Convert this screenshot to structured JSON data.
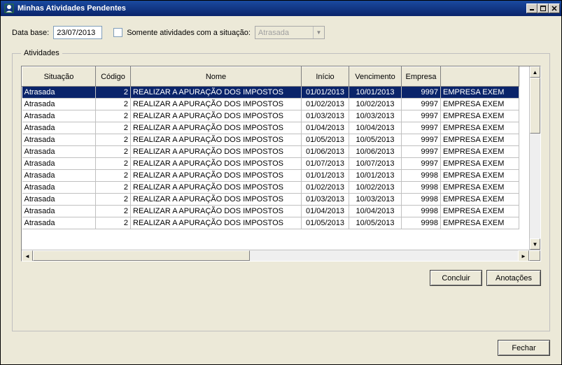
{
  "title": "Minhas Atividades Pendentes",
  "filter": {
    "data_base_label": "Data base:",
    "data_base_value": "23/07/2013",
    "checkbox_label": "Somente atividades com a situação:",
    "dropdown_value": "Atrasada"
  },
  "groupbox_label": "Atividades",
  "columns": {
    "sit": "Situação",
    "cod": "Código",
    "nome": "Nome",
    "ini": "Início",
    "venc": "Vencimento",
    "emp": "Empresa",
    "desc": ""
  },
  "rows": [
    {
      "sit": "Atrasada",
      "cod": "2",
      "nome": "REALIZAR A APURAÇÃO DOS IMPOSTOS",
      "ini": "01/01/2013",
      "venc": "10/01/2013",
      "emp": "9997",
      "desc": "EMPRESA EXEM",
      "selected": true
    },
    {
      "sit": "Atrasada",
      "cod": "2",
      "nome": "REALIZAR A APURAÇÃO DOS IMPOSTOS",
      "ini": "01/02/2013",
      "venc": "10/02/2013",
      "emp": "9997",
      "desc": "EMPRESA EXEM"
    },
    {
      "sit": "Atrasada",
      "cod": "2",
      "nome": "REALIZAR A APURAÇÃO DOS IMPOSTOS",
      "ini": "01/03/2013",
      "venc": "10/03/2013",
      "emp": "9997",
      "desc": "EMPRESA EXEM"
    },
    {
      "sit": "Atrasada",
      "cod": "2",
      "nome": "REALIZAR A APURAÇÃO DOS IMPOSTOS",
      "ini": "01/04/2013",
      "venc": "10/04/2013",
      "emp": "9997",
      "desc": "EMPRESA EXEM"
    },
    {
      "sit": "Atrasada",
      "cod": "2",
      "nome": "REALIZAR A APURAÇÃO DOS IMPOSTOS",
      "ini": "01/05/2013",
      "venc": "10/05/2013",
      "emp": "9997",
      "desc": "EMPRESA EXEM"
    },
    {
      "sit": "Atrasada",
      "cod": "2",
      "nome": "REALIZAR A APURAÇÃO DOS IMPOSTOS",
      "ini": "01/06/2013",
      "venc": "10/06/2013",
      "emp": "9997",
      "desc": "EMPRESA EXEM"
    },
    {
      "sit": "Atrasada",
      "cod": "2",
      "nome": "REALIZAR A APURAÇÃO DOS IMPOSTOS",
      "ini": "01/07/2013",
      "venc": "10/07/2013",
      "emp": "9997",
      "desc": "EMPRESA EXEM"
    },
    {
      "sit": "Atrasada",
      "cod": "2",
      "nome": "REALIZAR A APURAÇÃO DOS IMPOSTOS",
      "ini": "01/01/2013",
      "venc": "10/01/2013",
      "emp": "9998",
      "desc": "EMPRESA EXEM"
    },
    {
      "sit": "Atrasada",
      "cod": "2",
      "nome": "REALIZAR A APURAÇÃO DOS IMPOSTOS",
      "ini": "01/02/2013",
      "venc": "10/02/2013",
      "emp": "9998",
      "desc": "EMPRESA EXEM"
    },
    {
      "sit": "Atrasada",
      "cod": "2",
      "nome": "REALIZAR A APURAÇÃO DOS IMPOSTOS",
      "ini": "01/03/2013",
      "venc": "10/03/2013",
      "emp": "9998",
      "desc": "EMPRESA EXEM"
    },
    {
      "sit": "Atrasada",
      "cod": "2",
      "nome": "REALIZAR A APURAÇÃO DOS IMPOSTOS",
      "ini": "01/04/2013",
      "venc": "10/04/2013",
      "emp": "9998",
      "desc": "EMPRESA EXEM"
    },
    {
      "sit": "Atrasada",
      "cod": "2",
      "nome": "REALIZAR A APURAÇÃO DOS IMPOSTOS",
      "ini": "01/05/2013",
      "venc": "10/05/2013",
      "emp": "9998",
      "desc": "EMPRESA EXEM"
    }
  ],
  "buttons": {
    "concluir": "Concluir",
    "anotacoes": "Anotações",
    "fechar": "Fechar"
  }
}
